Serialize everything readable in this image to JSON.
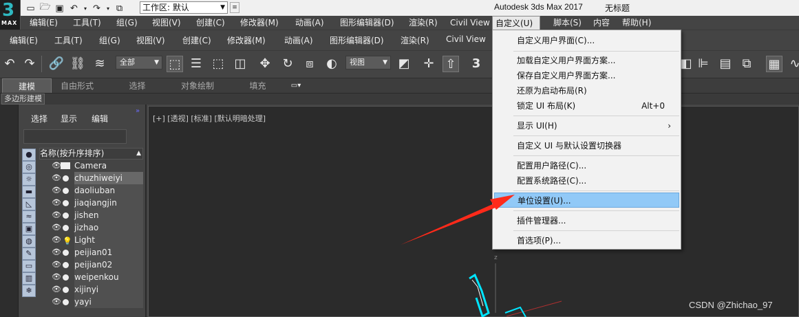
{
  "titlebar": {
    "logo_number": "3",
    "logo_text": "MAX",
    "workspace_label": "工作区: 默认",
    "app_title": "Autodesk 3ds Max 2017",
    "doc_title": "无标题"
  },
  "menubar": {
    "items": [
      "编辑(E)",
      "工具(T)",
      "组(G)",
      "视图(V)",
      "创建(C)",
      "修改器(M)",
      "动画(A)",
      "图形编辑器(D)",
      "渲染(R)",
      "Civil View",
      "自定义(U)",
      "脚本(S)",
      "内容",
      "帮助(H)"
    ]
  },
  "menubar2": {
    "items": [
      "编辑(E)",
      "工具(T)",
      "组(G)",
      "视图(V)",
      "创建(C)",
      "修改器(M)",
      "动画(A)",
      "图形编辑器(D)",
      "渲染(R)",
      "Civil View"
    ]
  },
  "toolbar": {
    "selection_filter": "全部",
    "ref_coord": "视图",
    "snap_label": "3"
  },
  "ribbon": {
    "tabs": [
      "建模",
      "自由形式",
      "选择",
      "对象绘制",
      "填充"
    ],
    "subtab": "多边形建模"
  },
  "explorer": {
    "menu": [
      "选择",
      "显示",
      "编辑"
    ],
    "column_header": "名称(按升序排序)",
    "objects": [
      "Camera",
      "chuzhiweiyi",
      "daoliuban",
      "jiaqiangjin",
      "jishen",
      "jizhao",
      "Light",
      "peijian01",
      "peijian02",
      "weipenkou",
      "xijinyi",
      "yayi"
    ],
    "selected": "chuzhiweiyi"
  },
  "viewport": {
    "label": "[+] [透视] [标准] [默认明暗处理]",
    "axis": "z"
  },
  "customize_menu": {
    "items": [
      {
        "label": "自定义用户界面(C)...",
        "shortcut": "",
        "submenu": false
      },
      {
        "label": "加载自定义用户界面方案...",
        "shortcut": "",
        "submenu": false
      },
      {
        "label": "保存自定义用户界面方案...",
        "shortcut": "",
        "submenu": false
      },
      {
        "label": "还原为启动布局(R)",
        "shortcut": "",
        "submenu": false
      },
      {
        "label": "锁定 UI 布局(K)",
        "shortcut": "Alt+0",
        "submenu": false
      },
      {
        "label": "显示 UI(H)",
        "shortcut": "",
        "submenu": true
      },
      {
        "label": "自定义 UI 与默认设置切换器",
        "shortcut": "",
        "submenu": false
      },
      {
        "label": "配置用户路径(C)...",
        "shortcut": "",
        "submenu": false
      },
      {
        "label": "配置系统路径(C)...",
        "shortcut": "",
        "submenu": false
      },
      {
        "label": "单位设置(U)...",
        "shortcut": "",
        "submenu": false
      },
      {
        "label": "插件管理器...",
        "shortcut": "",
        "submenu": false
      },
      {
        "label": "首选项(P)...",
        "shortcut": "",
        "submenu": false
      }
    ],
    "highlighted": "单位设置(U)..."
  },
  "watermark": "CSDN @Zhichao_97",
  "colors": {
    "menu_highlight": "#91c9f7",
    "annotation_arrow": "#ff2a1a",
    "selection_cyan": "#00e5ff"
  }
}
